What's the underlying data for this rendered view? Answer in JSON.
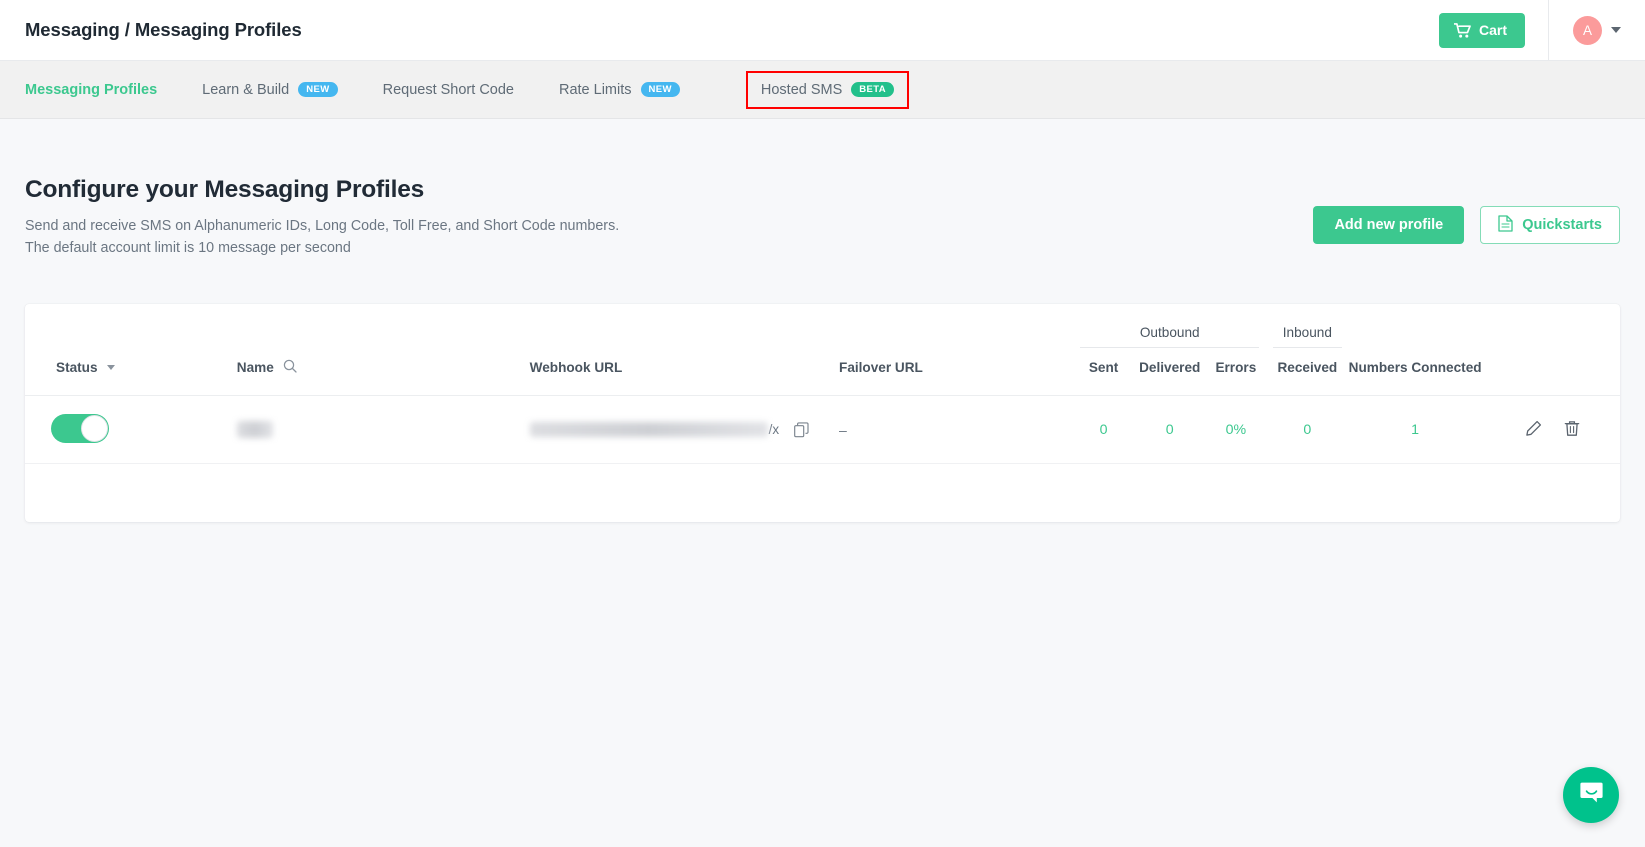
{
  "topbar": {
    "breadcrumb": "Messaging / Messaging Profiles",
    "cart_label": "Cart",
    "avatar_initial": "A"
  },
  "tabs": [
    {
      "label": "Messaging Profiles",
      "badge": null,
      "active": true,
      "highlighted": false
    },
    {
      "label": "Learn & Build",
      "badge": "NEW",
      "active": false,
      "highlighted": false
    },
    {
      "label": "Request Short Code",
      "badge": null,
      "active": false,
      "highlighted": false
    },
    {
      "label": "Rate Limits",
      "badge": "NEW",
      "active": false,
      "highlighted": false
    },
    {
      "label": "Hosted SMS",
      "badge": "BETA",
      "active": false,
      "highlighted": true
    }
  ],
  "page": {
    "title": "Configure your Messaging Profiles",
    "subtitle_line1": "Send and receive SMS on Alphanumeric IDs, Long Code, Toll Free, and Short Code numbers.",
    "subtitle_line2": "The default account limit is 10 message per second",
    "add_profile_label": "Add new profile",
    "quickstarts_label": "Quickstarts"
  },
  "table": {
    "group_headers": {
      "outbound": "Outbound",
      "inbound": "Inbound"
    },
    "columns": {
      "status": "Status",
      "name": "Name",
      "webhook_url": "Webhook URL",
      "failover_url": "Failover URL",
      "sent": "Sent",
      "delivered": "Delivered",
      "errors": "Errors",
      "received": "Received",
      "numbers_connected": "Numbers Connected"
    },
    "rows": [
      {
        "status_enabled": true,
        "name": "",
        "webhook_url_visible_tail": "/x",
        "failover_url": "–",
        "sent": "0",
        "delivered": "0",
        "errors": "0%",
        "received": "0",
        "numbers_connected": "1"
      }
    ]
  },
  "colors": {
    "brand_green": "#3cc88f",
    "badge_new_blue": "#45b7f0",
    "badge_beta_green": "#22c08b",
    "highlight_box_red": "#ff0000",
    "avatar_pink": "#fb9b9b",
    "chat_green": "#00c28c"
  },
  "icons": {
    "cart": "cart-icon",
    "chevron": "chevron-down-icon",
    "search": "search-icon",
    "document": "document-icon",
    "copy": "copy-icon",
    "edit": "pencil-icon",
    "delete": "trash-icon",
    "chat": "chat-bubble-icon"
  }
}
